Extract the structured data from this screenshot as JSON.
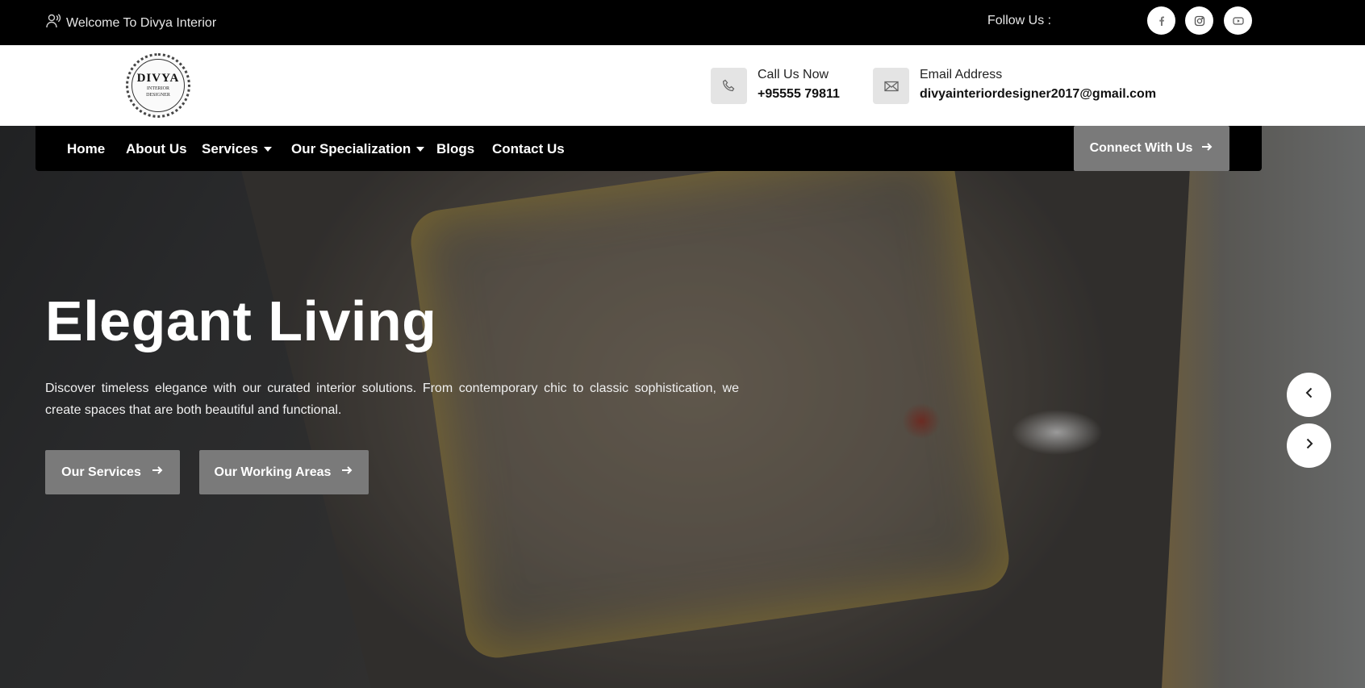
{
  "topbar": {
    "welcome": "Welcome To Divya Interior",
    "follow_label": "Follow Us :",
    "socials": [
      {
        "icon": "facebook-icon"
      },
      {
        "icon": "instagram-icon"
      },
      {
        "icon": "youtube-icon"
      }
    ]
  },
  "header": {
    "logo": {
      "line1": "DIVYA",
      "line2": "INTERIOR",
      "line3": "DESIGNER"
    },
    "call": {
      "label": "Call Us Now",
      "value": "+95555 79811",
      "icon": "phone-icon"
    },
    "email": {
      "label": "Email Address",
      "value": "divyainteriordesigner2017@gmail.com",
      "icon": "envelope-icon"
    }
  },
  "nav": {
    "items": [
      {
        "label": "Home"
      },
      {
        "label": "About Us"
      },
      {
        "label": "Services"
      },
      {
        "label": "Our Specialization"
      },
      {
        "label": "Blogs"
      },
      {
        "label": "Contact Us"
      }
    ],
    "cta": "Connect With Us"
  },
  "hero": {
    "title": "Elegant Living",
    "description": "Discover timeless elegance with our curated interior solutions. From contemporary chic to classic sophistication, we create spaces that are both beautiful and functional.",
    "buttons": [
      {
        "label": "Our Services"
      },
      {
        "label": "Our Working Areas"
      }
    ]
  },
  "colors": {
    "topbar_bg": "#000000",
    "nav_bg": "#000000",
    "button_bg": "#7a7a7a",
    "icon_box_bg": "#e4e4e4"
  }
}
